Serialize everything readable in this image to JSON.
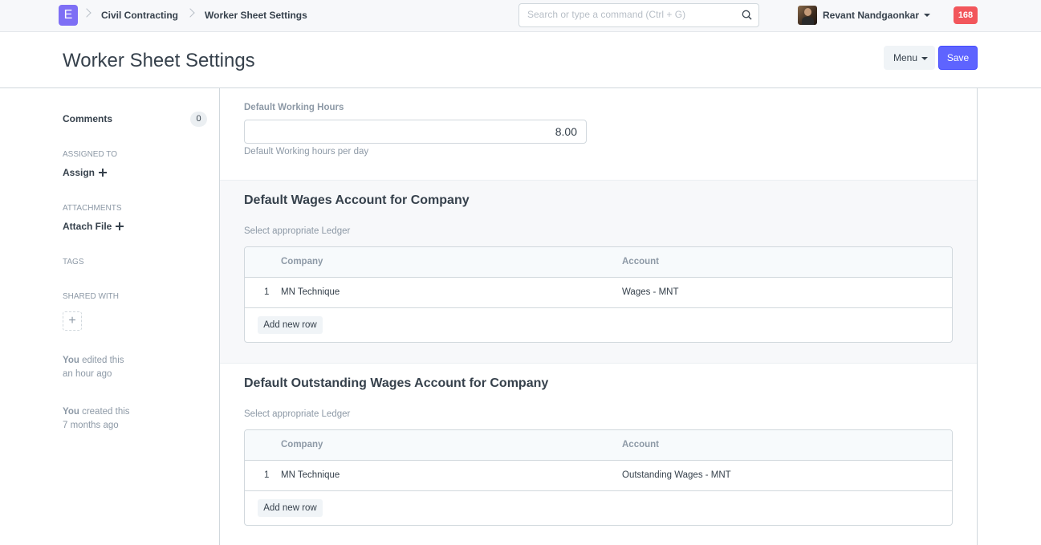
{
  "navbar": {
    "logo_letter": "E",
    "breadcrumbs": [
      "Civil Contracting",
      "Worker Sheet Settings"
    ],
    "search_placeholder": "Search or type a command (Ctrl + G)",
    "user_name": "Revant Nandgaonkar",
    "notification_count": "168",
    "accent_color": "#7e6ff5",
    "notification_color": "#f2565b"
  },
  "page": {
    "title": "Worker Sheet Settings",
    "menu_label": "Menu",
    "save_label": "Save",
    "primary_color": "#5e64ff"
  },
  "sidebar": {
    "comments_label": "Comments",
    "comments_count": "0",
    "assigned_to_label": "ASSIGNED TO",
    "assign_label": "Assign",
    "attachments_label": "ATTACHMENTS",
    "attach_label": "Attach File",
    "tags_label": "TAGS",
    "shared_with_label": "SHARED WITH",
    "activity": [
      {
        "who": "You",
        "action": "edited this",
        "when": "an hour ago"
      },
      {
        "who": "You",
        "action": "created this",
        "when": "7 months ago"
      }
    ]
  },
  "form": {
    "working_hours": {
      "label": "Default Working Hours",
      "value": "8.00",
      "description": "Default Working hours per day"
    },
    "wages_section": {
      "title": "Default Wages Account for Company",
      "description": "Select appropriate Ledger",
      "columns": [
        "Company",
        "Account"
      ],
      "rows": [
        {
          "idx": "1",
          "company": "MN Technique",
          "account": "Wages - MNT"
        }
      ],
      "add_row_label": "Add new row"
    },
    "outstanding_section": {
      "title": "Default Outstanding Wages Account for Company",
      "description": "Select appropriate Ledger",
      "columns": [
        "Company",
        "Account"
      ],
      "rows": [
        {
          "idx": "1",
          "company": "MN Technique",
          "account": "Outstanding Wages - MNT"
        }
      ],
      "add_row_label": "Add new row"
    }
  }
}
